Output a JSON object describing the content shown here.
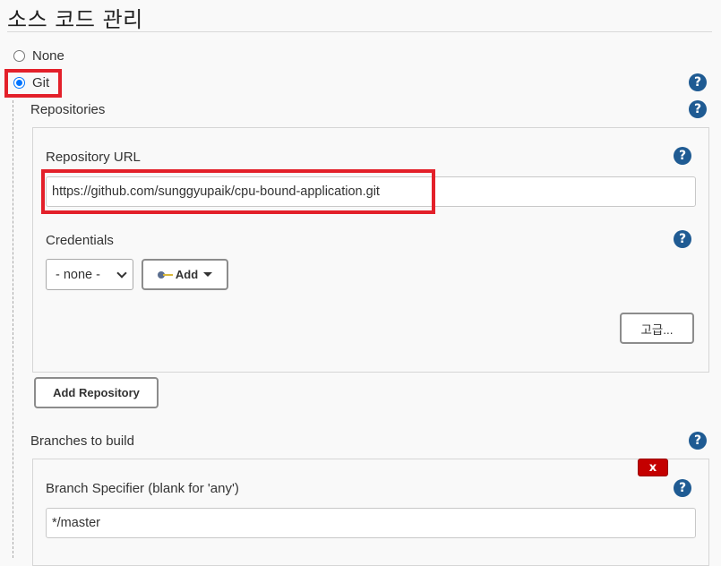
{
  "section": {
    "title": "소스 코드 관리"
  },
  "scm_options": [
    {
      "label": "None",
      "selected": false
    },
    {
      "label": "Git",
      "selected": true
    }
  ],
  "help_icon": {
    "glyph": "?"
  },
  "repositories": {
    "label": "Repositories",
    "repository_url": {
      "label": "Repository URL",
      "value": "https://github.com/sunggyupaik/cpu-bound-application.git"
    },
    "credentials": {
      "label": "Credentials",
      "selected": "- none -",
      "add_button": "Add"
    },
    "advanced_button": "고급...",
    "add_repository_button": "Add Repository"
  },
  "branches": {
    "label": "Branches to build",
    "delete_button": "x",
    "branch_specifier": {
      "label": "Branch Specifier (blank for 'any')",
      "value": "*/master"
    }
  },
  "colors": {
    "highlight": "#e3202a",
    "help": "#1f5b93",
    "radio_selected": "#0075ff",
    "delete": "#c40000"
  }
}
